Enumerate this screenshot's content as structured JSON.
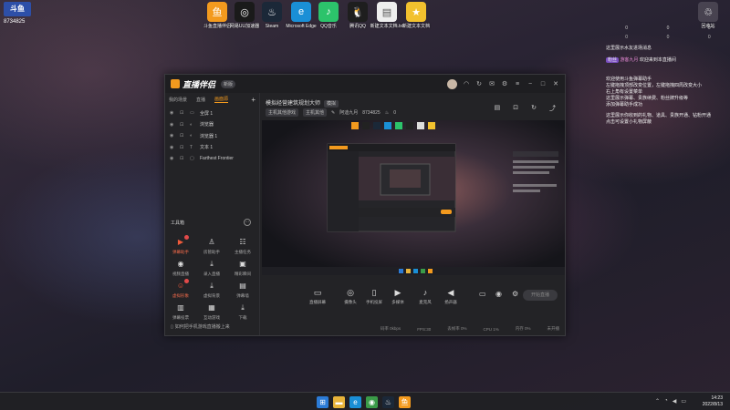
{
  "desktop": {
    "corner_logo": "斗鱼",
    "corner_number": "8734825",
    "icons": [
      {
        "label": "斗鱼直播伴侣",
        "icon": "douyu-companion-icon",
        "color": "#f39a1e",
        "glyph": "鱼"
      },
      {
        "label": "网易UU加速器",
        "icon": "uu-accelerator-icon",
        "color": "#1a1a1a",
        "glyph": "◎"
      },
      {
        "label": "Steam",
        "icon": "steam-icon",
        "color": "#1b2838",
        "glyph": "♨"
      },
      {
        "label": "Microsoft Edge",
        "icon": "edge-icon",
        "color": "#1a8fd6",
        "glyph": "e"
      },
      {
        "label": "QQ音乐",
        "icon": "qq-music-icon",
        "color": "#2cc36b",
        "glyph": "♪"
      },
      {
        "label": "腾讯QQ",
        "icon": "qq-icon",
        "color": "#1e1e1e",
        "glyph": "🐧"
      },
      {
        "label": "新建文本文档.txt",
        "icon": "text-file-icon",
        "color": "#eeeeee",
        "glyph": "▤"
      },
      {
        "label": "新建文本文档",
        "icon": "star-shortcut-icon",
        "color": "#f2c12e",
        "glyph": "★"
      }
    ],
    "recycle_bin": {
      "label": "回收站",
      "icon": "recycle-bin-icon"
    }
  },
  "panel": {
    "stats": [
      "0",
      "0",
      "0"
    ],
    "stats_row2": [
      "0",
      "0",
      "0"
    ],
    "lines": [
      "这里展示水友进场消息",
      "欢迎来到本直播间",
      "欢迎使用斗鱼弹幕助手",
      "左键拖拽顶部改变位置，左键拖拽四周改变大小",
      "右上角有设置菜单",
      "这里展示弹幕、贵族续费、粉丝牌升级等",
      "添加弹幕助手成功",
      "这里展示你收到的礼物、道具、贵族开通、钻粉开通",
      "点击可设置小礼物屏蔽"
    ],
    "badge": "粉丝",
    "user": "游客九月"
  },
  "app": {
    "name": "直播伴侣",
    "version": "新版",
    "tabs": [
      "我的场景",
      "直播",
      "画面源"
    ],
    "active_tab": 2,
    "scenes": [
      "全屏 1",
      "浏览器",
      "浏览器 1",
      "文本 1",
      "Farthest Frontier"
    ],
    "tools_title": "工具箱",
    "tools": [
      {
        "label": "弹幕助手",
        "icon": "danmaku-assistant-icon",
        "glyph": "▶",
        "hot": true,
        "dot": true
      },
      {
        "label": "房管助手",
        "icon": "room-manager-icon",
        "glyph": "♙",
        "hot": false,
        "dot": false
      },
      {
        "label": "主播任务",
        "icon": "streamer-tasks-icon",
        "glyph": "☷",
        "hot": false,
        "dot": false
      },
      {
        "label": "视频直播",
        "icon": "video-live-icon",
        "glyph": "◉",
        "hot": false,
        "dot": false
      },
      {
        "label": "录入直播",
        "icon": "record-icon",
        "glyph": "⤓",
        "hot": false,
        "dot": false
      },
      {
        "label": "精彩瞬间",
        "icon": "highlights-icon",
        "glyph": "▣",
        "hot": false,
        "dot": false
      },
      {
        "label": "虚拟形象",
        "icon": "virtual-avatar-icon",
        "glyph": "☺",
        "hot": true,
        "dot": true
      },
      {
        "label": "虚拟背景",
        "icon": "virtual-background-icon",
        "glyph": "⤓",
        "hot": false,
        "dot": false
      },
      {
        "label": "弹幕墙",
        "icon": "danmaku-wall-icon",
        "glyph": "▤",
        "hot": false,
        "dot": false
      },
      {
        "label": "弹幕投票",
        "icon": "danmaku-vote-icon",
        "glyph": "▥",
        "hot": false,
        "dot": false
      },
      {
        "label": "互动游戏",
        "icon": "interactive-game-icon",
        "glyph": "▦",
        "hot": false,
        "dot": false
      },
      {
        "label": "下载",
        "icon": "download-icon",
        "glyph": "⤓",
        "hot": false,
        "dot": false
      }
    ],
    "helper_text": "如何把手机游戏直播搬上来",
    "room_title": "模拟经营建筑规划大师",
    "room_tag": "模拟",
    "meta": {
      "category": "主机其他游戏",
      "sub": "主机其他",
      "name": "阿迪九月",
      "id": "8734825",
      "hot": "0"
    },
    "bottom_buttons": [
      {
        "label": "直播屏幕",
        "icon": "screen-capture-icon",
        "glyph": "▭"
      },
      {
        "label": "摄像头",
        "icon": "camera-icon",
        "glyph": "◎"
      },
      {
        "label": "手机投屏",
        "icon": "phone-cast-icon",
        "glyph": "▯"
      },
      {
        "label": "多媒体",
        "icon": "media-icon",
        "glyph": "▶"
      },
      {
        "label": "麦克风",
        "icon": "microphone-icon",
        "glyph": "♪"
      },
      {
        "label": "扬声器",
        "icon": "speaker-icon",
        "glyph": "◀"
      }
    ],
    "start_live": "开始直播",
    "status": [
      "码率 0kbps",
      "FPS:30",
      "丢帧率 0%",
      "CPU 1%",
      "内存 0%",
      "未开播"
    ]
  },
  "taskbar": {
    "icons": [
      {
        "icon": "windows-start-icon",
        "color": "#2b7bd6",
        "glyph": "⊞"
      },
      {
        "icon": "file-explorer-icon",
        "color": "#e8b43a",
        "glyph": "▬"
      },
      {
        "icon": "edge-icon",
        "color": "#1a8fd6",
        "glyph": "e"
      },
      {
        "icon": "chrome-icon",
        "color": "#3a9b48",
        "glyph": "◉"
      },
      {
        "icon": "steam-icon",
        "color": "#1b2838",
        "glyph": "♨"
      },
      {
        "icon": "douyu-companion-icon",
        "color": "#f39a1e",
        "glyph": "鱼"
      }
    ],
    "time": "14:23",
    "date": "2022/8/13"
  }
}
